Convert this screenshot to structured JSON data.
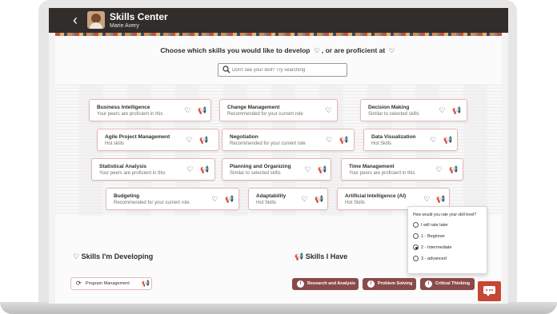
{
  "header": {
    "app_title": "Skills Center",
    "user_name": "Marie Avery",
    "back_icon": "chevron-left-icon"
  },
  "prompt": {
    "part1": "Choose which skills you would like to develop",
    "part2": ", or are proficient at",
    "develop_icon": "heart-icon",
    "proficient_icon": "megaphone-icon"
  },
  "search": {
    "placeholder": "Don't see your skill? Try searching"
  },
  "skills": [
    {
      "name": "Business Intelligence",
      "reason": "Your peers are proficient in this"
    },
    {
      "name": "Change Management",
      "reason": "Recommended for your current role"
    },
    {
      "name": "Decision Making",
      "reason": "Similar to selected skills"
    },
    {
      "name": "Agile Project Management",
      "reason": "Hot skills"
    },
    {
      "name": "Negotiation",
      "reason": "Recommended for your current role"
    },
    {
      "name": "Data Visualization",
      "reason": "Hot Skills"
    },
    {
      "name": "Statistical Analysis",
      "reason": "Your peers are proficient in this"
    },
    {
      "name": "Planning and Organizing",
      "reason": "Similar to selected skills"
    },
    {
      "name": "Time Management",
      "reason": "Your peers are proficient in this"
    },
    {
      "name": "Budgeting",
      "reason": "Recommended for your current role"
    },
    {
      "name": "Adaptability",
      "reason": "Hot Skills"
    },
    {
      "name": "Artificial Intelligence (AI)",
      "reason": "Hot Skills"
    }
  ],
  "developing": {
    "title": "Skills I'm Developing",
    "items": [
      "Program Management"
    ]
  },
  "have": {
    "title": "Skills I Have",
    "items": [
      "Research and Analysis",
      "Problem Solving",
      "Critical Thinking"
    ]
  },
  "rating_popup": {
    "question": "How would you rate your skill level?",
    "options": [
      "I will rate later",
      "1 - Beginner",
      "2 - Intermediate",
      "3 - advanced"
    ],
    "selected": "2 - Intermediate"
  },
  "chat": {
    "icon": "chat-bubble-icon"
  },
  "colors": {
    "accent": "#c74634",
    "header": "#312d2a",
    "chip": "#8a4a4a",
    "card_border": "#e3b9b4"
  }
}
